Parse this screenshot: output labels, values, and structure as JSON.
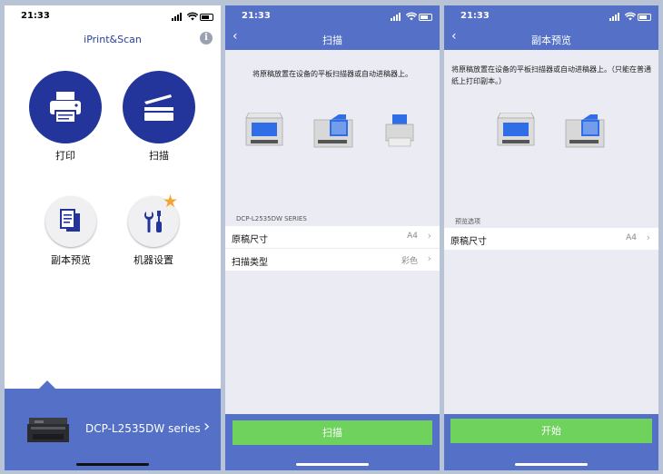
{
  "status_time": "21:33",
  "home": {
    "app_title": "iPrint&Scan",
    "info_label": "i",
    "print_label": "打印",
    "scan_label": "扫描",
    "copy_preview_label": "副本预览",
    "machine_settings_label": "机器设置",
    "device_name": "DCP-L2535DW series",
    "device_chevron": "›"
  },
  "scan": {
    "title": "扫描",
    "back": "‹",
    "instruction": "将原稿放置在设备的平板扫描器或自动进稿器上。",
    "section_label": "DCP-L2535DW SERIES",
    "rows": [
      {
        "label": "原稿尺寸",
        "value": "A4"
      },
      {
        "label": "扫描类型",
        "value": "彩色"
      }
    ],
    "chevron": "›",
    "button_label": "扫描"
  },
  "copy_preview": {
    "title": "副本预览",
    "back": "‹",
    "instruction": "将原稿放置在设备的平板扫描器或自动进稿器上。（只能在普通纸上打印副本。）",
    "section_label": "预览选项",
    "rows": [
      {
        "label": "原稿尺寸",
        "value": "A4"
      }
    ],
    "chevron": "›",
    "button_label": "开始"
  },
  "colors": {
    "header_blue": "#5470c7",
    "primary_navy": "#23359a",
    "button_green": "#6fd25c",
    "star_orange": "#f4a533"
  },
  "icons": [
    "printer-icon",
    "scanner-icon",
    "document-copy-icon",
    "tools-icon",
    "star-icon",
    "info-icon",
    "back-chevron-icon",
    "chevron-right-icon"
  ]
}
